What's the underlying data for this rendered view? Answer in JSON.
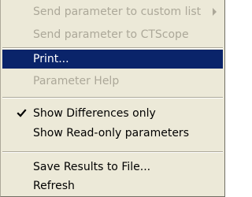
{
  "context_menu": {
    "items": [
      {
        "label": "Send parameter to custom list",
        "state": "disabled",
        "submenu": true
      },
      {
        "label": "Send parameter to CTScope",
        "state": "disabled"
      },
      {
        "label": "Print...",
        "state": "selected"
      },
      {
        "label": "Parameter Help",
        "state": "disabled"
      },
      {
        "label": "Show Differences only",
        "state": "enabled",
        "checked": true
      },
      {
        "label": "Show Read-only parameters",
        "state": "enabled"
      },
      {
        "label": "Save Results to File...",
        "state": "enabled"
      },
      {
        "label": "Refresh",
        "state": "enabled"
      }
    ],
    "icons": {
      "submenu": "submenu-arrow-icon",
      "check": "checkmark-icon"
    },
    "colors": {
      "background": "#ece9d8",
      "highlight": "#0a246a",
      "highlight_text": "#ffffff",
      "disabled_text": "#aca899"
    }
  }
}
